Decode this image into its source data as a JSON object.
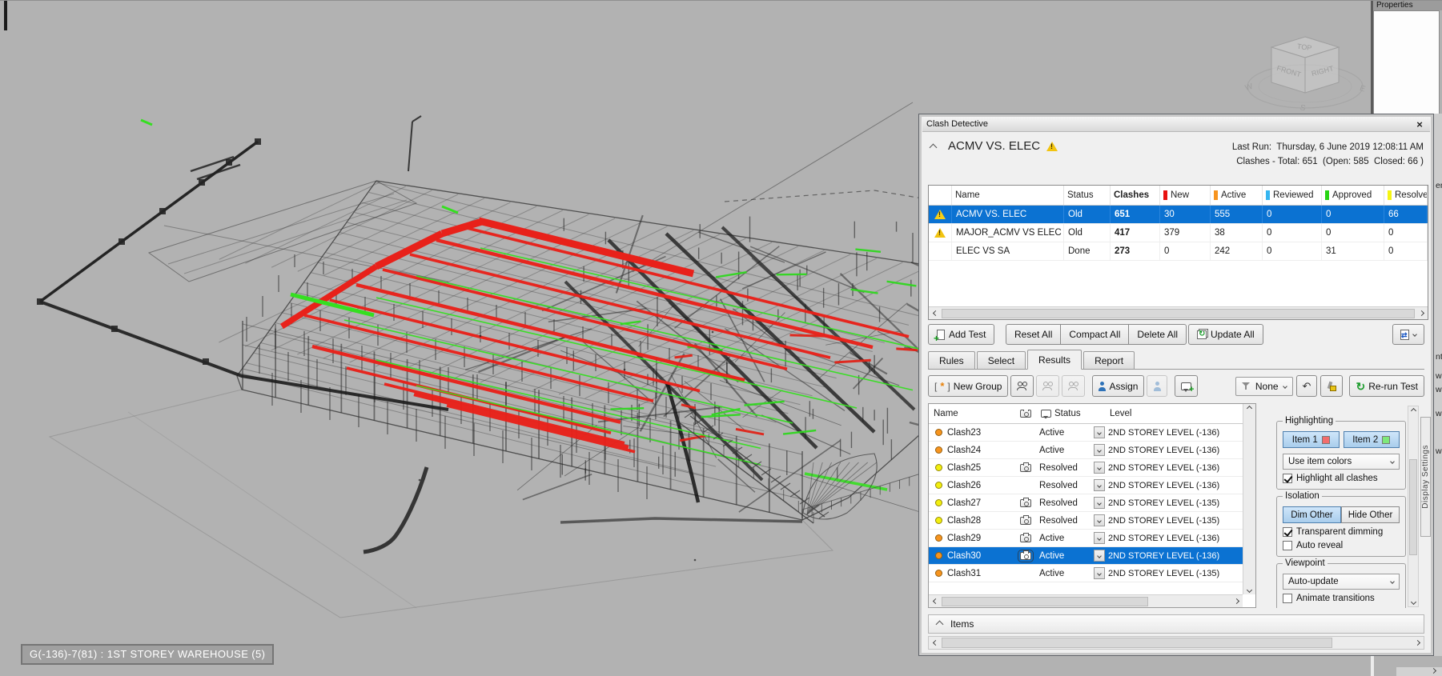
{
  "viewport": {
    "tooltip": "G(-136)-7(81) : 1ST STOREY WAREHOUSE (5)",
    "viewcube": {
      "top": "TOP",
      "front": "FRONT",
      "right": "RIGHT",
      "w": "W",
      "s": "S",
      "e": "E"
    }
  },
  "properties_panel": {
    "title": "Properties"
  },
  "edge_fragments": [
    "em",
    "nts",
    "w",
    "w",
    "w",
    "w"
  ],
  "clash_detective": {
    "window_title": "Clash Detective",
    "close_glyph": "×",
    "header": {
      "test_name": "ACMV VS. ELEC",
      "last_run_label": "Last Run:",
      "last_run_value": "Thursday, 6 June 2019 12:08:11 AM",
      "summary": "Clashes - Total: 651  (Open: 585  Closed: 66 )"
    },
    "tests_table": {
      "columns": [
        "Name",
        "Status",
        "Clashes",
        "New",
        "Active",
        "Reviewed",
        "Approved",
        "Resolved"
      ],
      "chip_colors": {
        "New": "#e8110f",
        "Active": "#f7941e",
        "Reviewed": "#35b5f0",
        "Approved": "#27d413",
        "Resolved": "#f5f513"
      },
      "rows": [
        {
          "name": "ACMV VS. ELEC",
          "status": "Old",
          "clashes": "651",
          "new": "30",
          "active": "555",
          "reviewed": "0",
          "approved": "0",
          "resolved": "66"
        },
        {
          "name": "MAJOR_ACMV VS ELEC",
          "status": "Old",
          "clashes": "417",
          "new": "379",
          "active": "38",
          "reviewed": "0",
          "approved": "0",
          "resolved": "0"
        },
        {
          "name": "ELEC VS SA",
          "status": "Done",
          "clashes": "273",
          "new": "0",
          "active": "242",
          "reviewed": "0",
          "approved": "31",
          "resolved": "0"
        }
      ]
    },
    "actions": {
      "add_test": "Add Test",
      "reset_all": "Reset All",
      "compact_all": "Compact All",
      "delete_all": "Delete All",
      "update_all": "Update All"
    },
    "tabs": [
      "Rules",
      "Select",
      "Results",
      "Report"
    ],
    "results_toolbar": {
      "new_group": "New Group",
      "assign": "Assign",
      "filter_value": "None",
      "rerun_test": "Re-run Test"
    },
    "results_grid": {
      "name_header": "Name",
      "status_header": "Status",
      "level_header": "Level",
      "dot_colors": {
        "orange": "#f7941e",
        "yellow": "#f2ef0f"
      },
      "rows": [
        {
          "name": "Clash23",
          "dot": "orange",
          "camera": false,
          "status": "Active",
          "level": "2ND STOREY LEVEL (-136)"
        },
        {
          "name": "Clash24",
          "dot": "orange",
          "camera": false,
          "status": "Active",
          "level": "2ND STOREY LEVEL (-136)"
        },
        {
          "name": "Clash25",
          "dot": "yellow",
          "camera": true,
          "status": "Resolved",
          "level": "2ND STOREY LEVEL (-136)"
        },
        {
          "name": "Clash26",
          "dot": "yellow",
          "camera": false,
          "status": "Resolved",
          "level": "2ND STOREY LEVEL (-136)"
        },
        {
          "name": "Clash27",
          "dot": "yellow",
          "camera": true,
          "status": "Resolved",
          "level": "2ND STOREY LEVEL (-135)"
        },
        {
          "name": "Clash28",
          "dot": "yellow",
          "camera": true,
          "status": "Resolved",
          "level": "2ND STOREY LEVEL (-135)"
        },
        {
          "name": "Clash29",
          "dot": "orange",
          "camera": true,
          "status": "Active",
          "level": "2ND STOREY LEVEL (-136)"
        },
        {
          "name": "Clash30",
          "dot": "orange",
          "camera": true,
          "status": "Active",
          "level": "2ND STOREY LEVEL (-136)"
        },
        {
          "name": "Clash31",
          "dot": "orange",
          "camera": false,
          "status": "Active",
          "level": "2ND STOREY LEVEL (-135)"
        }
      ]
    },
    "side_panel": {
      "highlighting": {
        "title": "Highlighting",
        "item1": "Item 1",
        "item2": "Item 2",
        "item1_color": "#f26d6d",
        "item2_color": "#7ee87a",
        "dropdown_value": "Use item colors",
        "highlight_all": "Highlight all clashes"
      },
      "isolation": {
        "title": "Isolation",
        "dim_other": "Dim Other",
        "hide_other": "Hide Other",
        "transparent_dimming": "Transparent dimming",
        "auto_reveal": "Auto reveal"
      },
      "viewpoint": {
        "title": "Viewpoint",
        "dropdown_value": "Auto-update",
        "animate_transitions": "Animate transitions"
      },
      "display_settings_tab": "Display Settings"
    },
    "items_section": {
      "label": "Items"
    }
  }
}
